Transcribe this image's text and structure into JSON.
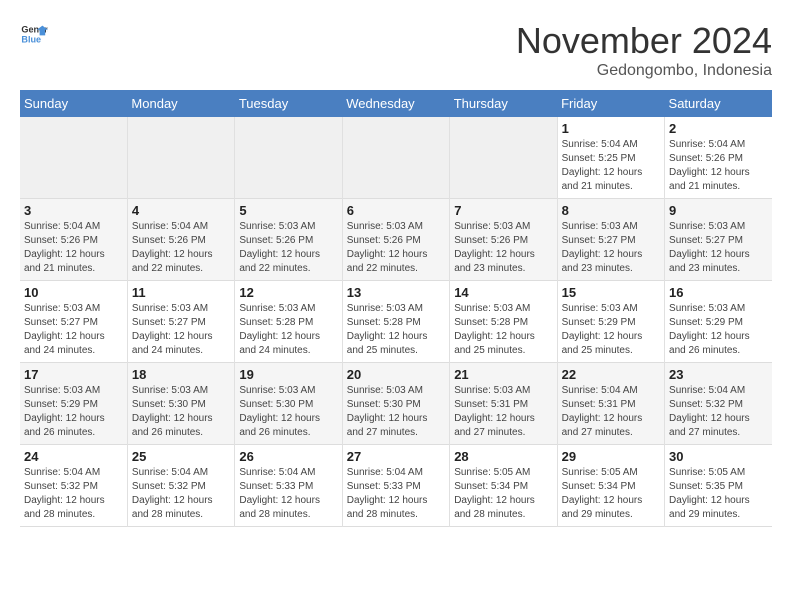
{
  "header": {
    "logo_line1": "General",
    "logo_line2": "Blue",
    "month": "November 2024",
    "location": "Gedongombo, Indonesia"
  },
  "days_of_week": [
    "Sunday",
    "Monday",
    "Tuesday",
    "Wednesday",
    "Thursday",
    "Friday",
    "Saturday"
  ],
  "weeks": [
    [
      {
        "day": "",
        "empty": true
      },
      {
        "day": "",
        "empty": true
      },
      {
        "day": "",
        "empty": true
      },
      {
        "day": "",
        "empty": true
      },
      {
        "day": "",
        "empty": true
      },
      {
        "day": "1",
        "sunrise": "Sunrise: 5:04 AM",
        "sunset": "Sunset: 5:25 PM",
        "daylight": "Daylight: 12 hours and 21 minutes."
      },
      {
        "day": "2",
        "sunrise": "Sunrise: 5:04 AM",
        "sunset": "Sunset: 5:26 PM",
        "daylight": "Daylight: 12 hours and 21 minutes."
      }
    ],
    [
      {
        "day": "3",
        "sunrise": "Sunrise: 5:04 AM",
        "sunset": "Sunset: 5:26 PM",
        "daylight": "Daylight: 12 hours and 21 minutes."
      },
      {
        "day": "4",
        "sunrise": "Sunrise: 5:04 AM",
        "sunset": "Sunset: 5:26 PM",
        "daylight": "Daylight: 12 hours and 22 minutes."
      },
      {
        "day": "5",
        "sunrise": "Sunrise: 5:03 AM",
        "sunset": "Sunset: 5:26 PM",
        "daylight": "Daylight: 12 hours and 22 minutes."
      },
      {
        "day": "6",
        "sunrise": "Sunrise: 5:03 AM",
        "sunset": "Sunset: 5:26 PM",
        "daylight": "Daylight: 12 hours and 22 minutes."
      },
      {
        "day": "7",
        "sunrise": "Sunrise: 5:03 AM",
        "sunset": "Sunset: 5:26 PM",
        "daylight": "Daylight: 12 hours and 23 minutes."
      },
      {
        "day": "8",
        "sunrise": "Sunrise: 5:03 AM",
        "sunset": "Sunset: 5:27 PM",
        "daylight": "Daylight: 12 hours and 23 minutes."
      },
      {
        "day": "9",
        "sunrise": "Sunrise: 5:03 AM",
        "sunset": "Sunset: 5:27 PM",
        "daylight": "Daylight: 12 hours and 23 minutes."
      }
    ],
    [
      {
        "day": "10",
        "sunrise": "Sunrise: 5:03 AM",
        "sunset": "Sunset: 5:27 PM",
        "daylight": "Daylight: 12 hours and 24 minutes."
      },
      {
        "day": "11",
        "sunrise": "Sunrise: 5:03 AM",
        "sunset": "Sunset: 5:27 PM",
        "daylight": "Daylight: 12 hours and 24 minutes."
      },
      {
        "day": "12",
        "sunrise": "Sunrise: 5:03 AM",
        "sunset": "Sunset: 5:28 PM",
        "daylight": "Daylight: 12 hours and 24 minutes."
      },
      {
        "day": "13",
        "sunrise": "Sunrise: 5:03 AM",
        "sunset": "Sunset: 5:28 PM",
        "daylight": "Daylight: 12 hours and 25 minutes."
      },
      {
        "day": "14",
        "sunrise": "Sunrise: 5:03 AM",
        "sunset": "Sunset: 5:28 PM",
        "daylight": "Daylight: 12 hours and 25 minutes."
      },
      {
        "day": "15",
        "sunrise": "Sunrise: 5:03 AM",
        "sunset": "Sunset: 5:29 PM",
        "daylight": "Daylight: 12 hours and 25 minutes."
      },
      {
        "day": "16",
        "sunrise": "Sunrise: 5:03 AM",
        "sunset": "Sunset: 5:29 PM",
        "daylight": "Daylight: 12 hours and 26 minutes."
      }
    ],
    [
      {
        "day": "17",
        "sunrise": "Sunrise: 5:03 AM",
        "sunset": "Sunset: 5:29 PM",
        "daylight": "Daylight: 12 hours and 26 minutes."
      },
      {
        "day": "18",
        "sunrise": "Sunrise: 5:03 AM",
        "sunset": "Sunset: 5:30 PM",
        "daylight": "Daylight: 12 hours and 26 minutes."
      },
      {
        "day": "19",
        "sunrise": "Sunrise: 5:03 AM",
        "sunset": "Sunset: 5:30 PM",
        "daylight": "Daylight: 12 hours and 26 minutes."
      },
      {
        "day": "20",
        "sunrise": "Sunrise: 5:03 AM",
        "sunset": "Sunset: 5:30 PM",
        "daylight": "Daylight: 12 hours and 27 minutes."
      },
      {
        "day": "21",
        "sunrise": "Sunrise: 5:03 AM",
        "sunset": "Sunset: 5:31 PM",
        "daylight": "Daylight: 12 hours and 27 minutes."
      },
      {
        "day": "22",
        "sunrise": "Sunrise: 5:04 AM",
        "sunset": "Sunset: 5:31 PM",
        "daylight": "Daylight: 12 hours and 27 minutes."
      },
      {
        "day": "23",
        "sunrise": "Sunrise: 5:04 AM",
        "sunset": "Sunset: 5:32 PM",
        "daylight": "Daylight: 12 hours and 27 minutes."
      }
    ],
    [
      {
        "day": "24",
        "sunrise": "Sunrise: 5:04 AM",
        "sunset": "Sunset: 5:32 PM",
        "daylight": "Daylight: 12 hours and 28 minutes."
      },
      {
        "day": "25",
        "sunrise": "Sunrise: 5:04 AM",
        "sunset": "Sunset: 5:32 PM",
        "daylight": "Daylight: 12 hours and 28 minutes."
      },
      {
        "day": "26",
        "sunrise": "Sunrise: 5:04 AM",
        "sunset": "Sunset: 5:33 PM",
        "daylight": "Daylight: 12 hours and 28 minutes."
      },
      {
        "day": "27",
        "sunrise": "Sunrise: 5:04 AM",
        "sunset": "Sunset: 5:33 PM",
        "daylight": "Daylight: 12 hours and 28 minutes."
      },
      {
        "day": "28",
        "sunrise": "Sunrise: 5:05 AM",
        "sunset": "Sunset: 5:34 PM",
        "daylight": "Daylight: 12 hours and 28 minutes."
      },
      {
        "day": "29",
        "sunrise": "Sunrise: 5:05 AM",
        "sunset": "Sunset: 5:34 PM",
        "daylight": "Daylight: 12 hours and 29 minutes."
      },
      {
        "day": "30",
        "sunrise": "Sunrise: 5:05 AM",
        "sunset": "Sunset: 5:35 PM",
        "daylight": "Daylight: 12 hours and 29 minutes."
      }
    ]
  ]
}
